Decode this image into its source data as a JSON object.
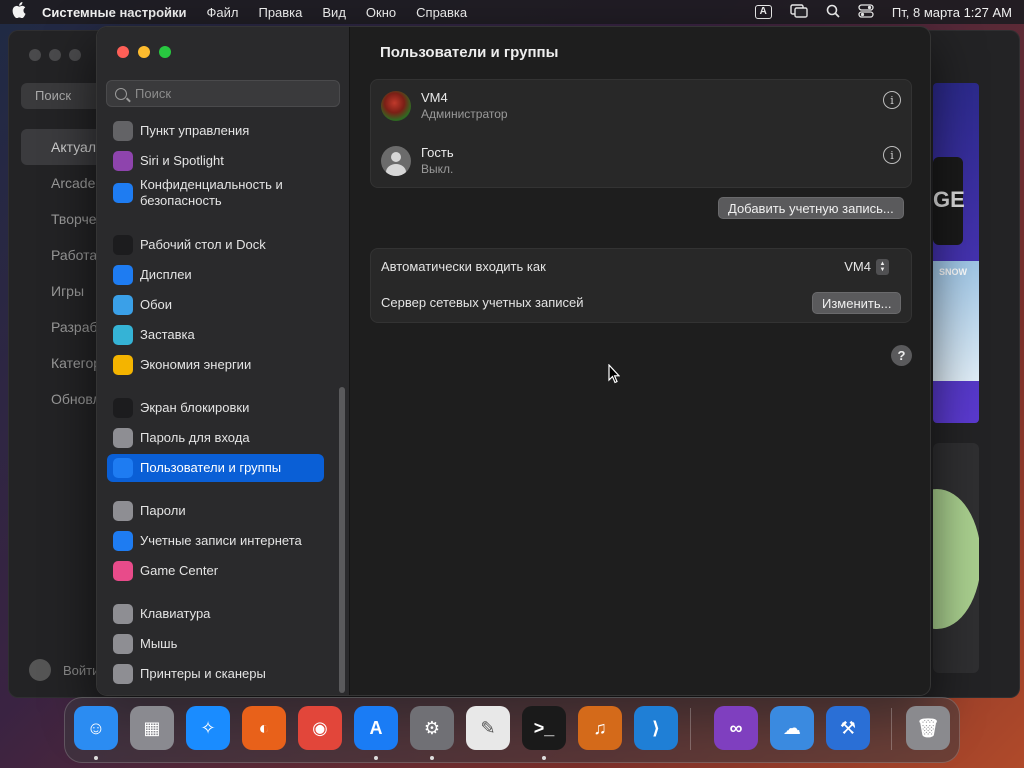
{
  "menubar": {
    "apple": "",
    "app_name": "Системные настройки",
    "items": [
      "Файл",
      "Правка",
      "Вид",
      "Окно",
      "Справка"
    ],
    "input_source": "A",
    "datetime": "Пт, 8 марта  1:27 AM"
  },
  "background_app": {
    "search_label": "Поиск",
    "nav": [
      "Актуальное",
      "Arcade",
      "Творчество",
      "Работа",
      "Игры",
      "Разработка",
      "Категории",
      "Обновления"
    ],
    "signin": "Войти",
    "banner_text": "GE",
    "banner_text2": "SNOW"
  },
  "settings": {
    "search_placeholder": "Поиск",
    "sidebar": [
      {
        "label": "Пункт управления",
        "icon": "control-center-icon",
        "color": "#636366"
      },
      {
        "label": "Siri и Spotlight",
        "icon": "siri-icon",
        "color": "#8e44ad"
      },
      {
        "label": "Конфиденциальность и безопасность",
        "icon": "hand-privacy-icon",
        "color": "#1e7cf2"
      },
      {
        "label": "Рабочий стол и Dock",
        "icon": "dock-icon",
        "color": "#1c1c1e"
      },
      {
        "label": "Дисплеи",
        "icon": "display-sun-icon",
        "color": "#1e7cf2"
      },
      {
        "label": "Обои",
        "icon": "wallpaper-flower-icon",
        "color": "#3aa0e8"
      },
      {
        "label": "Заставка",
        "icon": "screensaver-icon",
        "color": "#35b3d6"
      },
      {
        "label": "Экономия энергии",
        "icon": "energy-bulb-icon",
        "color": "#f4b400"
      },
      {
        "label": "Экран блокировки",
        "icon": "lock-screen-icon",
        "color": "#1c1c1e"
      },
      {
        "label": "Пароль для входа",
        "icon": "login-password-icon",
        "color": "#8e8e93"
      },
      {
        "label": "Пользователи и группы",
        "icon": "users-groups-icon",
        "color": "#1e7cf2"
      },
      {
        "label": "Пароли",
        "icon": "key-icon",
        "color": "#8e8e93"
      },
      {
        "label": "Учетные записи интернета",
        "icon": "at-sign-icon",
        "color": "#1e7cf2"
      },
      {
        "label": "Game Center",
        "icon": "game-center-icon",
        "color": "#e84b8a"
      },
      {
        "label": "Клавиатура",
        "icon": "keyboard-icon",
        "color": "#8e8e93"
      },
      {
        "label": "Мышь",
        "icon": "mouse-icon",
        "color": "#8e8e93"
      },
      {
        "label": "Принтеры и сканеры",
        "icon": "printer-icon",
        "color": "#8e8e93"
      }
    ],
    "page_title": "Пользователи и группы",
    "users": [
      {
        "name": "VM4",
        "role": "Администратор"
      },
      {
        "name": "Гость",
        "role": "Выкл."
      }
    ],
    "add_account_label": "Добавить учетную запись...",
    "auto_login_label": "Автоматически входить как",
    "auto_login_value": "VM4",
    "network_server_label": "Сервер сетевых учетных записей",
    "edit_label": "Изменить...",
    "help_label": "?",
    "info_glyph": "i"
  },
  "dock": [
    {
      "name": "finder",
      "color": "#2b8cf2",
      "glyph": "☺"
    },
    {
      "name": "launchpad",
      "color": "#8a8a90",
      "glyph": "▦"
    },
    {
      "name": "safari",
      "color": "#1a8cff",
      "glyph": "✧"
    },
    {
      "name": "firefox",
      "color": "#e8611a",
      "glyph": "◐"
    },
    {
      "name": "chrome",
      "color": "#e2463a",
      "glyph": "◉"
    },
    {
      "name": "app-store",
      "color": "#1a7cf5",
      "glyph": "A"
    },
    {
      "name": "system-settings",
      "color": "#707075",
      "glyph": "⚙"
    },
    {
      "name": "textedit",
      "color": "#e8e8e8",
      "glyph": "✎"
    },
    {
      "name": "terminal",
      "color": "#1a1a1a",
      "glyph": ">_"
    },
    {
      "name": "garageband",
      "color": "#d46a1a",
      "glyph": "♫"
    },
    {
      "name": "vscode",
      "color": "#1f7fd6",
      "glyph": "⟩"
    },
    {
      "name": "visual-studio",
      "color": "#7f3fbf",
      "glyph": "∞"
    },
    {
      "name": "weather",
      "color": "#3a8ae0",
      "glyph": "☁"
    },
    {
      "name": "xcode",
      "color": "#2a6fd6",
      "glyph": "⚒"
    },
    {
      "name": "trash",
      "color": "#8a8a8e",
      "glyph": "🗑"
    }
  ]
}
